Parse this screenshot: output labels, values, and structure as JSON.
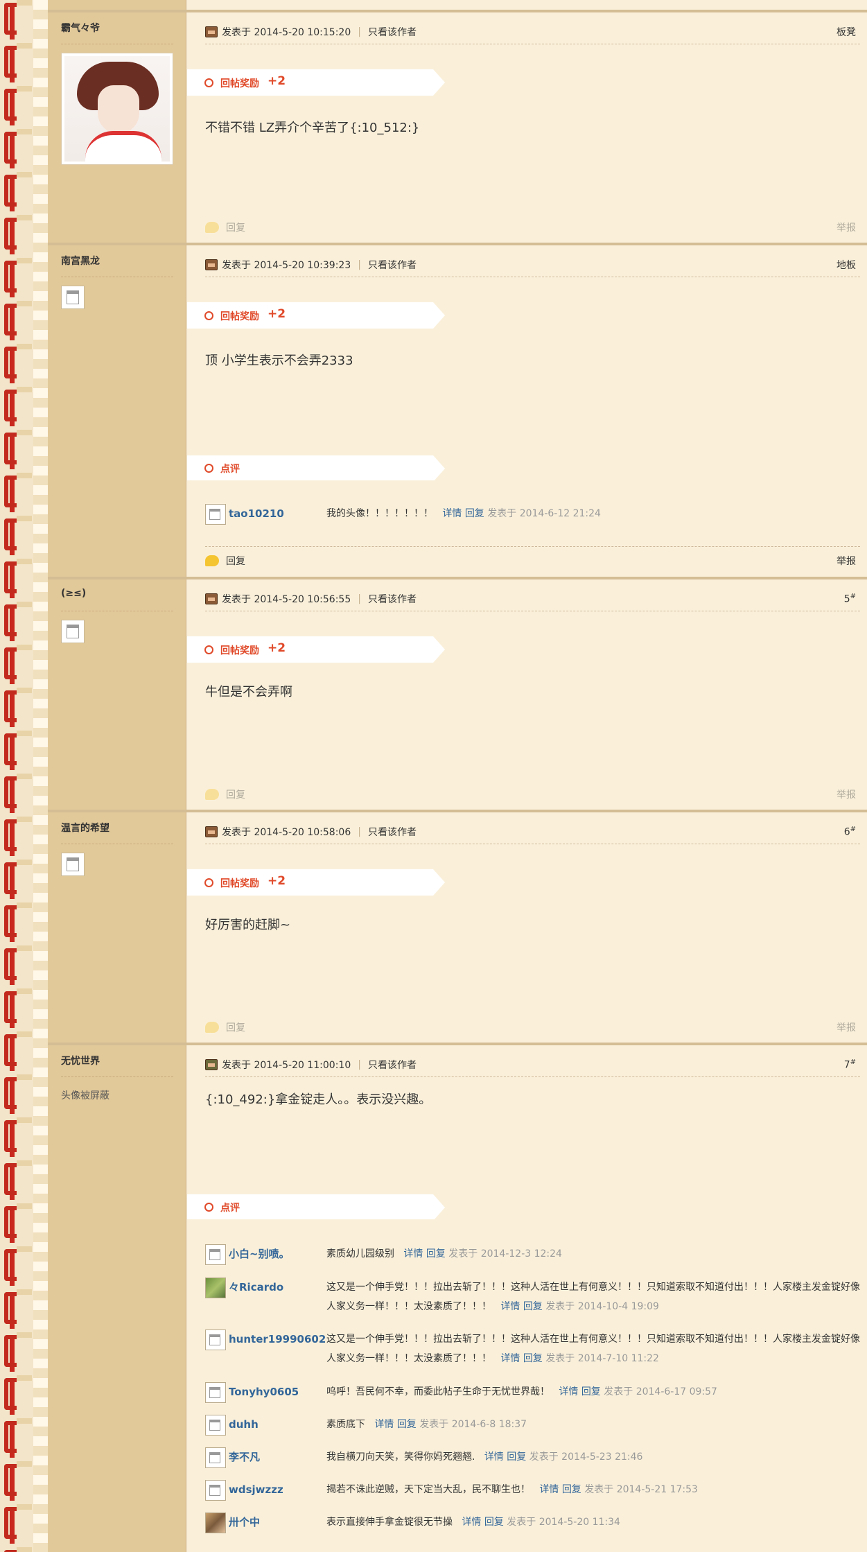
{
  "posts": [
    {
      "author": "霸气々爷",
      "time": "发表于 2014-5-20 10:15:20",
      "only_author": "只看该作者",
      "floor": "板凳",
      "floor_sup": "",
      "reward_label": "回帖奖励",
      "reward_points": "+2",
      "content": "不错不错 LZ弄介个辛苦了{:10_512:}",
      "reply": "回复",
      "report": "举报"
    },
    {
      "author": "南宫黑龙",
      "time": "发表于 2014-5-20 10:39:23",
      "only_author": "只看该作者",
      "floor": "地板",
      "floor_sup": "",
      "reward_label": "回帖奖励",
      "reward_points": "+2",
      "content": "顶  小学生表示不会弄2333",
      "comment_label": "点评",
      "reply": "回复",
      "report": "举报",
      "comments": [
        {
          "user": "tao10210",
          "text": "我的头像！！！！！！！",
          "detail": "详情",
          "reply": "回复",
          "time": "发表于 2014-6-12 21:24"
        }
      ]
    },
    {
      "author": "(≥≤)",
      "time": "发表于 2014-5-20 10:56:55",
      "only_author": "只看该作者",
      "floor": "5",
      "floor_sup": "#",
      "reward_label": "回帖奖励",
      "reward_points": "+2",
      "content": "牛但是不会弄啊",
      "reply": "回复",
      "report": "举报"
    },
    {
      "author": "温言的希望",
      "time": "发表于 2014-5-20 10:58:06",
      "only_author": "只看该作者",
      "floor": "6",
      "floor_sup": "#",
      "reward_label": "回帖奖励",
      "reward_points": "+2",
      "content": "好厉害的赶脚~",
      "reply": "回复",
      "report": "举报"
    },
    {
      "author": "无忧世界",
      "avatar_blocked": "头像被屏蔽",
      "time": "发表于 2014-5-20 11:00:10",
      "only_author": "只看该作者",
      "floor": "7",
      "floor_sup": "#",
      "content": "{:10_492:}拿金锭走人。。表示没兴趣。",
      "comment_label": "点评",
      "comments": [
        {
          "user": "小白~别喷。",
          "text": "素质幼儿园级别",
          "detail": "详情",
          "reply": "回复",
          "time": "发表于 2014-12-3 12:24"
        },
        {
          "user": "々Ricardo",
          "text": "这又是一个伸手党！！！拉出去斩了！！！这种人活在世上有何意义！！！只知道索取不知道付出！！！人家楼主发金锭好像人家义务一样！！！太没素质了！！！",
          "detail": "详情",
          "reply": "回复",
          "time": "发表于 2014-10-4 19:09"
        },
        {
          "user": "hunter19990602",
          "text": "这又是一个伸手党！！！拉出去斩了！！！这种人活在世上有何意义！！！只知道索取不知道付出！！！人家楼主发金锭好像人家义务一样！！！太没素质了！！！",
          "detail": "详情",
          "reply": "回复",
          "time": "发表于 2014-7-10 11:22"
        },
        {
          "user": "Tonyhy0605",
          "text": "呜呼！吾民何不幸，而委此帖子生命于无忧世界哉！",
          "detail": "详情",
          "reply": "回复",
          "time": "发表于 2014-6-17 09:57"
        },
        {
          "user": "duhh",
          "text": "素质底下",
          "detail": "详情",
          "reply": "回复",
          "time": "发表于 2014-6-8 18:37"
        },
        {
          "user": "李不凡",
          "text": "我自横刀向天笑，笑得你妈死翘翘.",
          "detail": "详情",
          "reply": "回复",
          "time": "发表于 2014-5-23 21:46"
        },
        {
          "user": "wdsjwzzz",
          "text": "揭若不诛此逆贼，天下定当大乱，民不聊生也！",
          "detail": "详情",
          "reply": "回复",
          "time": "发表于 2014-5-21 17:53"
        },
        {
          "user": "卅个中",
          "text": "表示直接伸手拿金锭很无节操",
          "detail": "详情",
          "reply": "回复",
          "time": "发表于 2014-5-20 11:34"
        }
      ]
    }
  ]
}
